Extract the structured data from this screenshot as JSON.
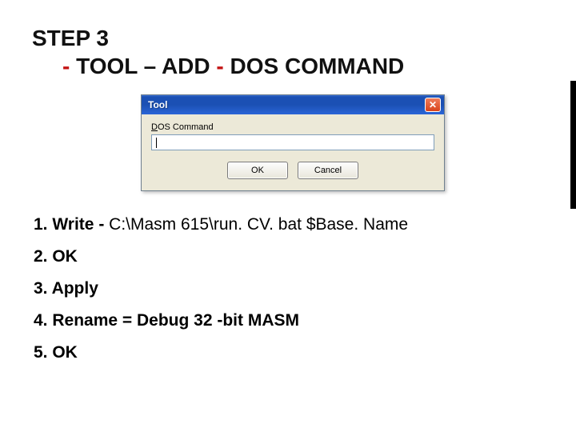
{
  "heading": {
    "line1": "STEP 3",
    "indent_dash": "-",
    "line2_main": " TOOL – ADD ",
    "line2_dash2": "-",
    "line2_tail": " DOS COMMAND"
  },
  "dialog": {
    "title": "Tool",
    "close_glyph": "✕",
    "label_underline": "D",
    "label_rest": "OS Command",
    "input_value": "",
    "ok_label": "OK",
    "cancel_label": "Cancel"
  },
  "steps": {
    "s1_lead": "1. Write  ",
    "s1_dash": "-",
    "s1_cmd": " C:\\Masm 615\\run. CV. bat $Base. Name",
    "s2": "2. OK",
    "s3": "3. Apply",
    "s4": "4. Rename = Debug 32 -bit MASM",
    "s5": "5. OK"
  }
}
